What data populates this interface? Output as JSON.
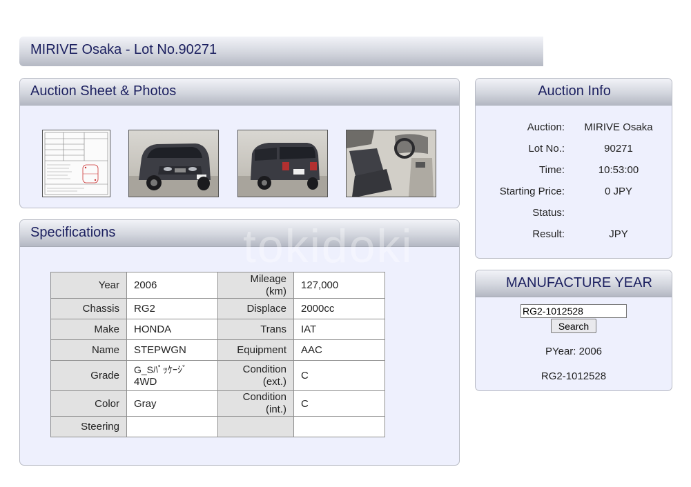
{
  "title": "MIRIVE Osaka - Lot No.90271",
  "watermark": "tokidoki",
  "sheet_panel": {
    "heading": "Auction Sheet & Photos",
    "thumbnails": [
      {
        "kind": "auction-sheet",
        "icon": "auction-sheet-icon"
      },
      {
        "kind": "car-front",
        "icon": "car-front-photo"
      },
      {
        "kind": "car-rear",
        "icon": "car-rear-photo"
      },
      {
        "kind": "car-interior",
        "icon": "car-interior-photo"
      }
    ]
  },
  "specs": {
    "heading": "Specifications",
    "rows": [
      {
        "l1": "Year",
        "v1": "2006",
        "l2a": "Mileage",
        "l2b": "(km)",
        "v2": "127,000"
      },
      {
        "l1": "Chassis",
        "v1": "RG2",
        "l2": "Displace",
        "v2": "2000cc"
      },
      {
        "l1": "Make",
        "v1": "HONDA",
        "l2": "Trans",
        "v2": "IAT"
      },
      {
        "l1": "Name",
        "v1": "STEPWGN",
        "l2": "Equipment",
        "v2": "AAC"
      },
      {
        "l1": "Grade",
        "v1a": "G_Sﾊﾟｯｹｰｼﾞ",
        "v1b": "4WD",
        "l2a": "Condition",
        "l2b": "(ext.)",
        "v2": "C"
      },
      {
        "l1": "Color",
        "v1": "Gray",
        "l2a": "Condition",
        "l2b": "(int.)",
        "v2": "C"
      },
      {
        "l1": "Steering",
        "v1": "",
        "l2": "",
        "v2": ""
      }
    ]
  },
  "auction_info": {
    "heading": "Auction Info",
    "rows": [
      {
        "label": "Auction:",
        "value": "MIRIVE Osaka"
      },
      {
        "label": "Lot No.:",
        "value": "90271"
      },
      {
        "label": "Time:",
        "value": "10:53:00"
      },
      {
        "label": "Starting Price:",
        "value": "0 JPY"
      },
      {
        "label": "Status:",
        "value": ""
      },
      {
        "label": "Result:",
        "value": "JPY"
      }
    ]
  },
  "manufacture_year": {
    "heading": "MANUFACTURE YEAR",
    "input_value": "RG2-1012528",
    "button_label": "Search",
    "pyear": "PYear: 2006",
    "chassis_result": "RG2-1012528"
  }
}
